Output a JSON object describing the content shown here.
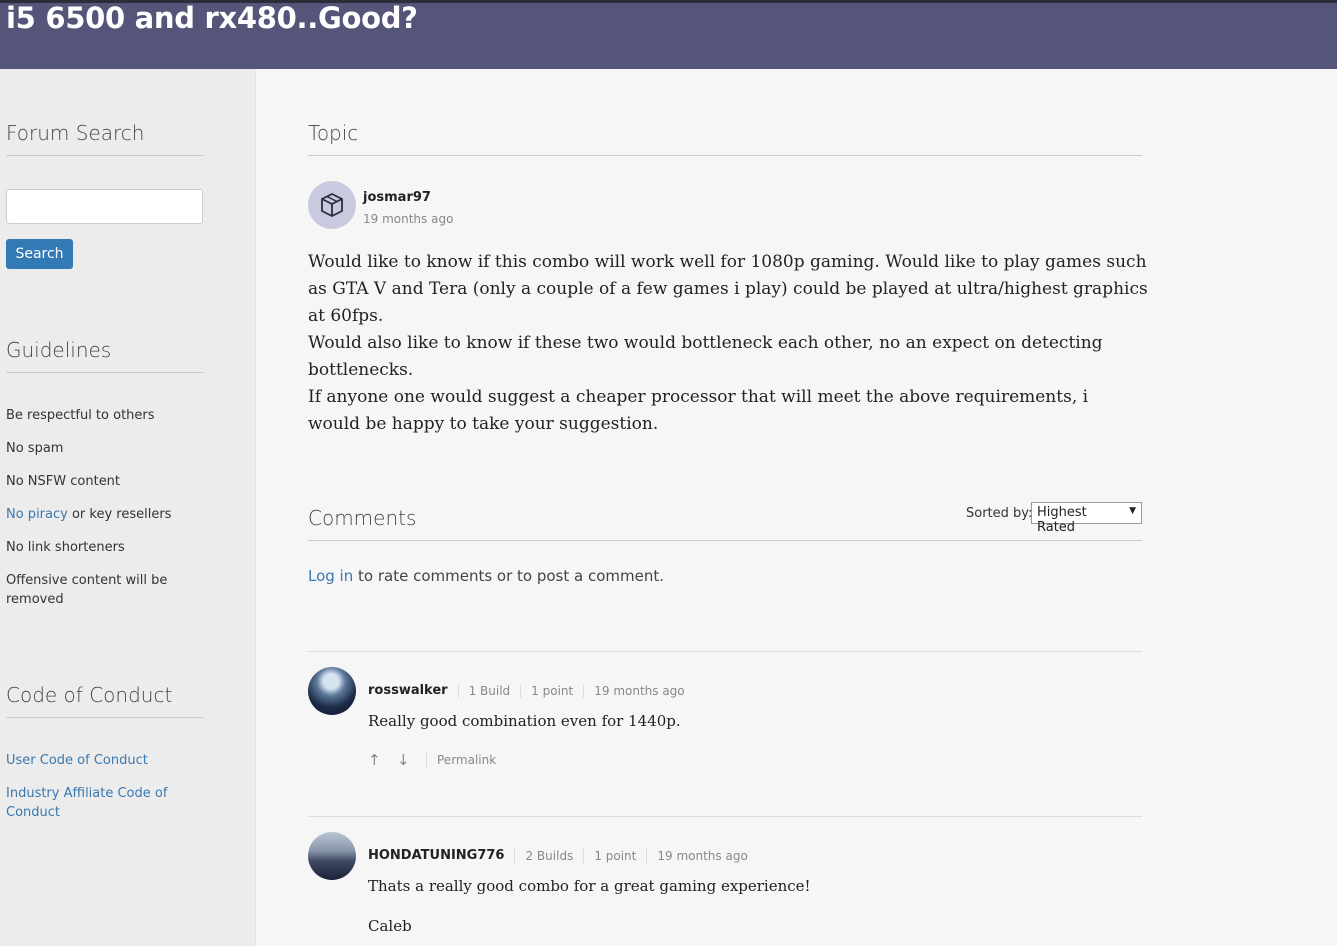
{
  "header": {
    "title": "i5 6500 and rx480..Good?"
  },
  "sidebar": {
    "search_heading": "Forum Search",
    "search_button": "Search",
    "guidelines_heading": "Guidelines",
    "guidelines": [
      "Be respectful to others",
      "No spam",
      "No NSFW content",
      {
        "link": "No piracy",
        "rest": " or key resellers"
      },
      "No link shorteners",
      "Offensive content will be removed"
    ],
    "conduct_heading": "Code of Conduct",
    "conduct_links": [
      "User Code of Conduct",
      "Industry Affiliate Code of Conduct"
    ]
  },
  "topic": {
    "heading": "Topic",
    "author": "josmar97",
    "time": "19 months ago",
    "paragraphs": [
      "Would like to know if this combo will work well for 1080p gaming. Would like to play games such as GTA V and Tera (only a couple of a few games i play) could be played at ultra/highest graphics at 60fps.",
      "Would also like to know if these two would bottleneck each other, no an expect on detecting bottlenecks.",
      "If anyone one would suggest a cheaper processor that will meet the above requirements, i would be happy to take your suggestion."
    ]
  },
  "comments": {
    "heading": "Comments",
    "sorted_label": "Sorted by:",
    "sorted_value": "Highest Rated",
    "login_link": "Log in",
    "login_rest": " to rate comments or to post a comment.",
    "items": [
      {
        "user": "rosswalker",
        "builds": "1 Build",
        "points": "1 point",
        "time": "19 months ago",
        "text": "Really good combination even for 1440p.",
        "permalink": "Permalink"
      },
      {
        "user": "HONDATUNING776",
        "builds": "2 Builds",
        "points": "1 point",
        "time": "19 months ago",
        "text": "Thats a really good combo for a great gaming experience!",
        "text2": "Caleb"
      }
    ]
  }
}
